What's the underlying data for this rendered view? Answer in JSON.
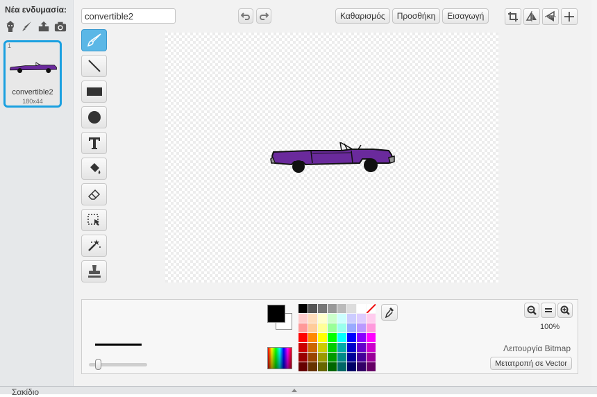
{
  "costume_pane": {
    "new_costume_label": "Νέα ενδυμασία:",
    "new_costume_icons": [
      "sprite-library-icon",
      "paint-brush-icon",
      "upload-icon",
      "camera-icon"
    ],
    "costumes": [
      {
        "index": "1",
        "name": "convertible2",
        "size": "180x44",
        "selected": true
      }
    ]
  },
  "editor": {
    "costume_name_value": "convertible2",
    "buttons": {
      "clear": "Καθαρισμός",
      "add": "Προσθήκη",
      "import": "Εισαγωγή"
    },
    "tools": [
      "brush-tool",
      "line-tool",
      "rectangle-tool",
      "ellipse-tool",
      "text-tool",
      "fill-tool",
      "eraser-tool",
      "select-tool",
      "magic-select-tool",
      "stamp-tool"
    ],
    "selected_tool": "brush-tool",
    "right_tools": [
      "crop-icon",
      "flip-horizontal-icon",
      "flip-vertical-icon",
      "set-center-icon"
    ]
  },
  "bottom_panel": {
    "zoom_level": "100%",
    "mode_label": "Λειτουργία Bitmap",
    "convert_button": "Μετατροπή σε Vector",
    "foreground_color": "#000000",
    "background_color": "#ffffff",
    "palette": [
      "#000000",
      "#555555",
      "#777777",
      "#999999",
      "#bbbbbb",
      "#dddddd",
      "#ffffff",
      "none",
      "#ffcccc",
      "#ffddbb",
      "#ffffcc",
      "#ccffcc",
      "#ccffff",
      "#ccccff",
      "#ddccff",
      "#ffccee",
      "#ff9999",
      "#ffcc99",
      "#ffff99",
      "#99ff99",
      "#99ffee",
      "#99aaff",
      "#bb99ff",
      "#ff99dd",
      "#ff0000",
      "#ff8800",
      "#ffff00",
      "#00ff00",
      "#00ffff",
      "#0000ff",
      "#8800ff",
      "#ff00ff",
      "#cc0000",
      "#cc6600",
      "#cccc00",
      "#00cc00",
      "#00aaaa",
      "#0000cc",
      "#6600cc",
      "#cc00cc",
      "#990000",
      "#994400",
      "#999900",
      "#009900",
      "#008888",
      "#000099",
      "#440099",
      "#990099",
      "#660000",
      "#663300",
      "#666600",
      "#006600",
      "#006666",
      "#000066",
      "#330066",
      "#660066"
    ]
  },
  "backpack": {
    "label": "Σακίδιο"
  }
}
